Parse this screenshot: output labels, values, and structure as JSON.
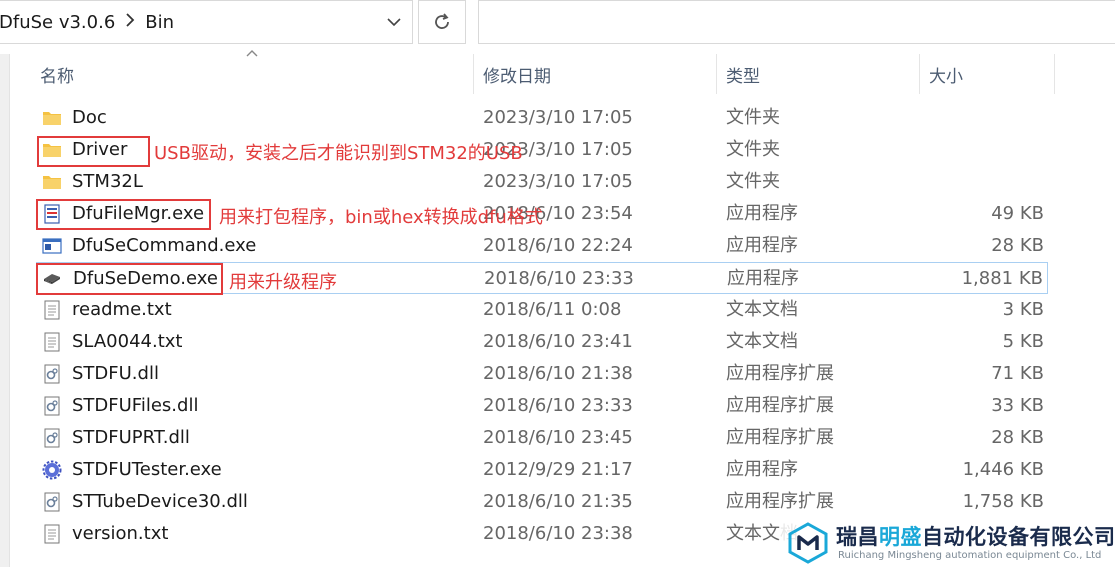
{
  "address_bar": {
    "crumbs": [
      "DfuSe v3.0.6",
      "Bin"
    ],
    "separator_icon": "chevron-right-icon",
    "dropdown_icon": "chevron-down-icon",
    "refresh_icon": "refresh-icon"
  },
  "search": {
    "placeholder": ""
  },
  "columns": {
    "name": "名称",
    "date": "修改日期",
    "type": "类型",
    "size": "大小"
  },
  "files": [
    {
      "name": "Doc",
      "date": "2023/3/10 17:05",
      "type": "文件夹",
      "size": "",
      "icon": "folder-icon"
    },
    {
      "name": "Driver",
      "date": "2023/3/10 17:05",
      "type": "文件夹",
      "size": "",
      "icon": "folder-icon"
    },
    {
      "name": "STM32L",
      "date": "2023/3/10 17:05",
      "type": "文件夹",
      "size": "",
      "icon": "folder-icon"
    },
    {
      "name": "DfuFileMgr.exe",
      "date": "2018/6/10 23:54",
      "type": "应用程序",
      "size": "49 KB",
      "icon": "file-manager-app-icon"
    },
    {
      "name": "DfuSeCommand.exe",
      "date": "2018/6/10 22:24",
      "type": "应用程序",
      "size": "28 KB",
      "icon": "console-app-icon"
    },
    {
      "name": "DfuSeDemo.exe",
      "date": "2018/6/10 23:33",
      "type": "应用程序",
      "size": "1,881 KB",
      "icon": "chip-app-icon"
    },
    {
      "name": "readme.txt",
      "date": "2018/6/11 0:08",
      "type": "文本文档",
      "size": "3 KB",
      "icon": "text-file-icon"
    },
    {
      "name": "SLA0044.txt",
      "date": "2018/6/10 23:41",
      "type": "文本文档",
      "size": "5 KB",
      "icon": "text-file-icon"
    },
    {
      "name": "STDFU.dll",
      "date": "2018/6/10 21:38",
      "type": "应用程序扩展",
      "size": "71 KB",
      "icon": "dll-file-icon"
    },
    {
      "name": "STDFUFiles.dll",
      "date": "2018/6/10 23:33",
      "type": "应用程序扩展",
      "size": "33 KB",
      "icon": "dll-file-icon"
    },
    {
      "name": "STDFUPRT.dll",
      "date": "2018/6/10 23:45",
      "type": "应用程序扩展",
      "size": "28 KB",
      "icon": "dll-file-icon"
    },
    {
      "name": "STDFUTester.exe",
      "date": "2012/9/29 21:17",
      "type": "应用程序",
      "size": "1,446 KB",
      "icon": "gear-app-icon"
    },
    {
      "name": "STTubeDevice30.dll",
      "date": "2018/6/10 21:35",
      "type": "应用程序扩展",
      "size": "1,758 KB",
      "icon": "dll-file-icon"
    },
    {
      "name": "version.txt",
      "date": "2018/6/10 23:38",
      "type": "文本文档",
      "size": "",
      "icon": "text-file-icon"
    }
  ],
  "annotations": {
    "driver": "USB驱动，安装之后才能识别到STM32的USB",
    "filemgr": "用来打包程序，bin或hex转换成dfu格式",
    "demo": "用来升级程序"
  },
  "watermark": {
    "cn_a": "瑞昌",
    "cn_b": "明盛",
    "cn_c": "自动化设备有限公司",
    "en": "Ruichang Mingsheng automation equipment Co., Ltd",
    "colors": {
      "dark": "#1a2b4c",
      "cyan": "#1aa8d8"
    }
  },
  "colors": {
    "annotation_red": "#e23b3b",
    "highlight_border": "#a9cff2",
    "folder_yellow": "#f5c242"
  }
}
